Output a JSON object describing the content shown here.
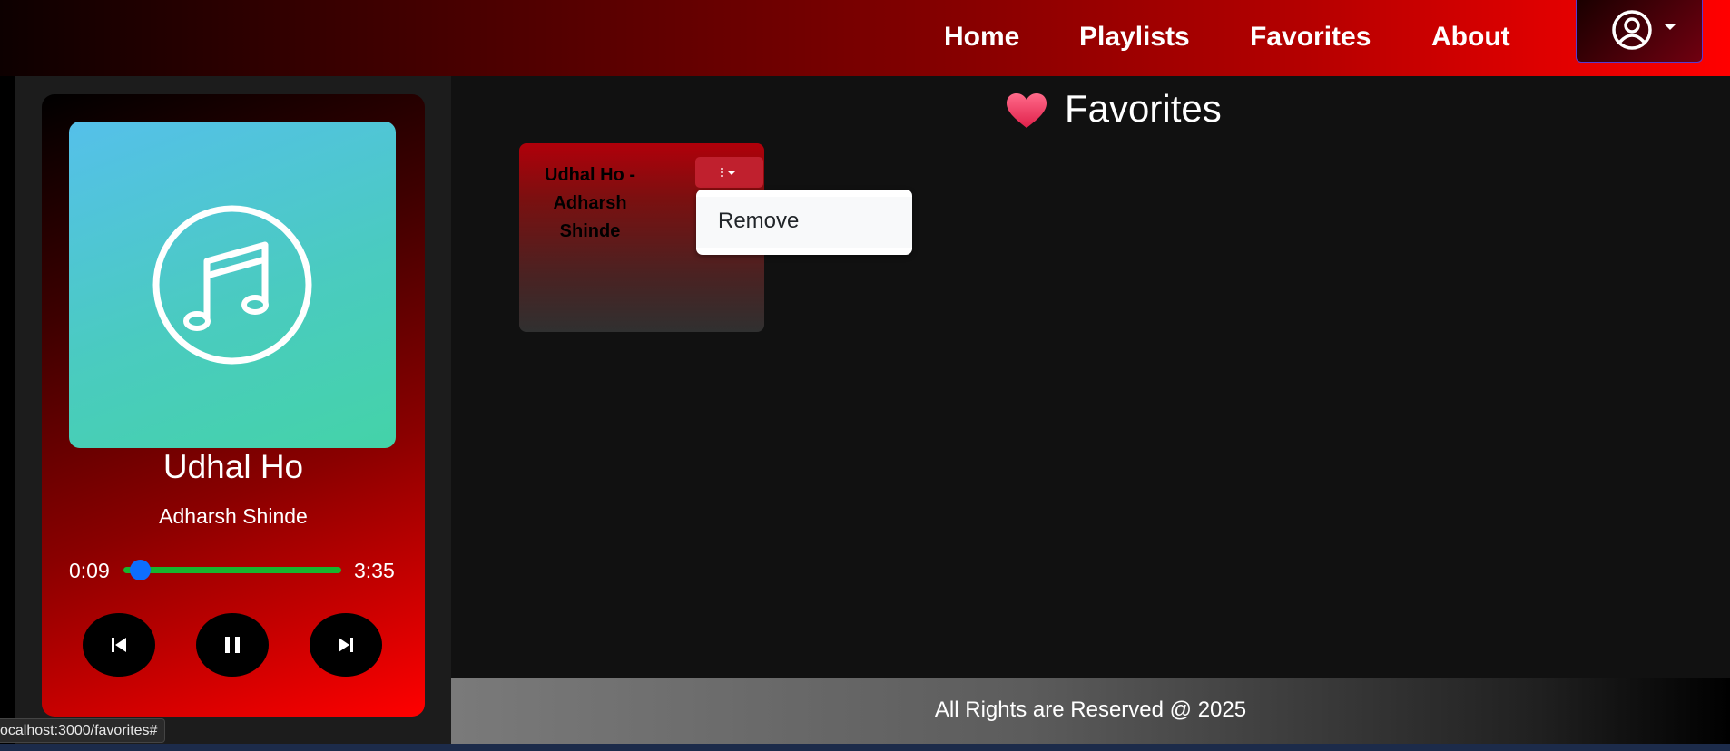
{
  "nav": {
    "links": [
      "Home",
      "Playlists",
      "Favorites",
      "About"
    ],
    "profile_icon": "user-circle-icon"
  },
  "player": {
    "art_icon": "music-note-icon",
    "title": "Udhal Ho",
    "artist": "Adharsh Shinde",
    "current_time": "0:09",
    "total_time": "3:35",
    "progress": 0.042,
    "controls": [
      "previous-icon",
      "pause-icon",
      "next-icon"
    ],
    "seek_color": "#18b52e",
    "thumb_color": "#0d6efd"
  },
  "main": {
    "heading_icon": "heart-icon",
    "heading": "Favorites",
    "cards": [
      {
        "title": "Udhal Ho - Adharsh Shinde",
        "menu_icon": "kebab-menu-icon"
      }
    ],
    "dropdown": {
      "items": [
        "Remove"
      ]
    }
  },
  "footer": {
    "text": "All Rights are Reserved @ 2025"
  },
  "status_bar": {
    "url": "ocalhost:3000/favorites#"
  }
}
